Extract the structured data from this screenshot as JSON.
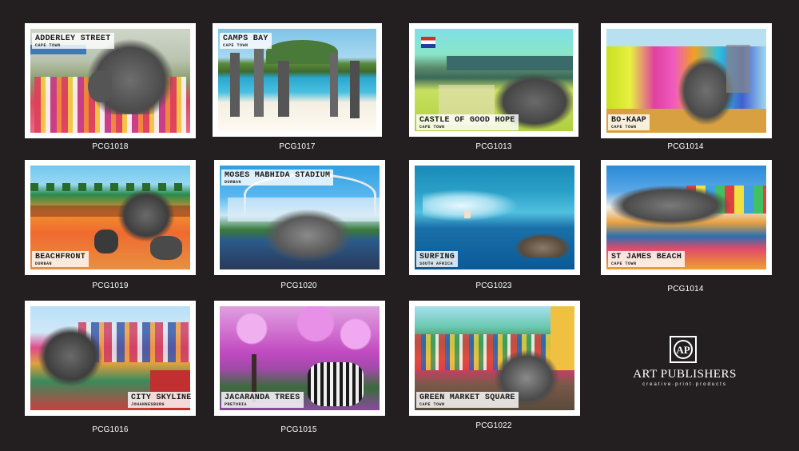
{
  "cards": [
    {
      "title": "ADDERLEY STREET",
      "sub": "CAPE TOWN",
      "code": "PCG1018"
    },
    {
      "title": "CAMPS BAY",
      "sub": "CAPE TOWN",
      "code": "PCG1017"
    },
    {
      "title": "CASTLE OF GOOD HOPE",
      "sub": "CAPE TOWN",
      "code": "PCG1013"
    },
    {
      "title": "BO-KAAP",
      "sub": "CAPE TOWN",
      "code": "PCG1014"
    },
    {
      "title": "BEACHFRONT",
      "sub": "DURBAN",
      "code": "PCG1019"
    },
    {
      "title": "MOSES MABHIDA STADIUM",
      "sub": "DURBAN",
      "code": "PCG1020"
    },
    {
      "title": "SURFING",
      "sub": "SOUTH AFRICA",
      "code": "PCG1023"
    },
    {
      "title": "ST JAMES BEACH",
      "sub": "CAPE TOWN",
      "code": "PCG1014"
    },
    {
      "title": "CITY SKYLINE",
      "sub": "JOHANNESBURG",
      "code": "PCG1016"
    },
    {
      "title": "JACARANDA TREES",
      "sub": "PRETORIA",
      "code": "PCG1015"
    },
    {
      "title": "GREEN MARKET SQUARE",
      "sub": "CAPE TOWN",
      "code": "PCG1022"
    }
  ],
  "logo": {
    "mark": "AP",
    "name": "ART PUBLISHERS",
    "tagline": "creative·print·products"
  }
}
